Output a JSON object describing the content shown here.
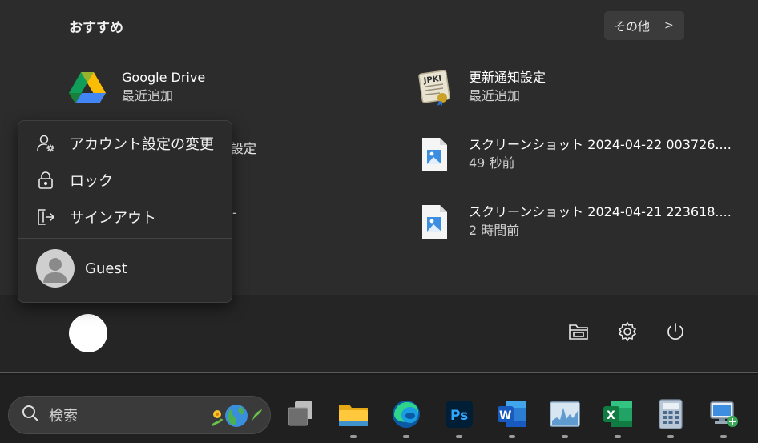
{
  "start_menu": {
    "recommended_title": "おすすめ",
    "more_button": {
      "label": "その他",
      "chevron": ">"
    },
    "recommended_items": [
      {
        "name": "Google Drive",
        "sub": "最近追加",
        "icon": "google-drive-icon"
      },
      {
        "name": "更新通知設定",
        "sub": "最近追加",
        "icon": "jpki-certificate-icon"
      },
      {
        "name": "スクリーンショット 2024-04-22 003726....",
        "sub": "49 秒前",
        "icon": "image-file-icon"
      },
      {
        "name": "スクリーンショット 2024-04-21 223618....",
        "sub": "2 時間前",
        "icon": "image-file-icon"
      }
    ],
    "partial_hidden_texts": [
      "設定",
      "-"
    ],
    "jpki_badge_text": "JPKI"
  },
  "account_flyout": {
    "items": [
      {
        "label": "アカウント設定の変更",
        "icon": "person-gear-icon"
      },
      {
        "label": "ロック",
        "icon": "lock-icon"
      },
      {
        "label": "サインアウト",
        "icon": "sign-out-icon"
      }
    ],
    "user": {
      "name": "Guest",
      "icon": "guest-avatar-icon"
    }
  },
  "footer": {
    "icons": [
      "file-explorer-icon",
      "settings-gear-icon",
      "power-icon"
    ]
  },
  "taskbar": {
    "search_placeholder": "検索",
    "apps": [
      {
        "name": "task-view-icon",
        "running": false
      },
      {
        "name": "file-explorer-icon",
        "running": true
      },
      {
        "name": "edge-icon",
        "running": true
      },
      {
        "name": "photoshop-icon",
        "running": true,
        "text": "Ps"
      },
      {
        "name": "word-icon",
        "running": true,
        "text": "W"
      },
      {
        "name": "resource-monitor-icon",
        "running": true
      },
      {
        "name": "excel-icon",
        "running": true,
        "text": "X"
      },
      {
        "name": "calculator-icon",
        "running": true
      },
      {
        "name": "remote-desktop-icon",
        "running": true
      }
    ]
  },
  "colors": {
    "panel_bg": "#2c2c2c",
    "flyout_bg": "#2b2b2b",
    "taskbar_bg": "#202020",
    "accent_blue": "#1a73e8"
  }
}
